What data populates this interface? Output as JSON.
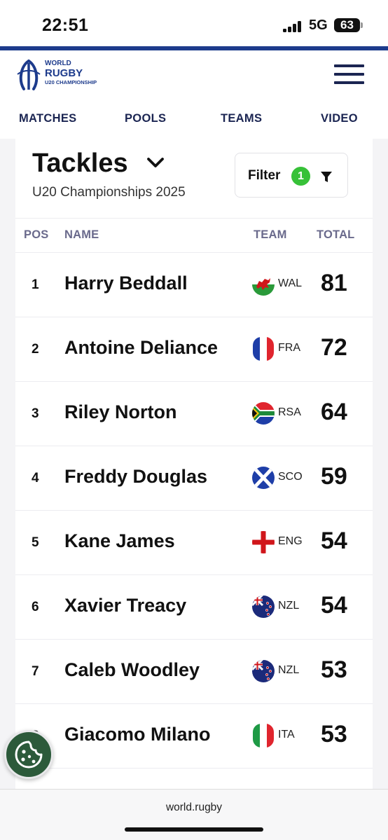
{
  "status_bar": {
    "time": "22:51",
    "network": "5G",
    "battery": "63"
  },
  "header": {
    "logo": {
      "line1": "WORLD",
      "line2": "RUGBY",
      "line3": "U20 CHAMPIONSHIP"
    },
    "nav": [
      "MATCHES",
      "POOLS",
      "TEAMS",
      "VIDEO"
    ]
  },
  "stats": {
    "title": "Tackles",
    "subtitle": "U20 Championships 2025",
    "filter": {
      "label": "Filter",
      "count": "1"
    },
    "columns": {
      "pos": "POS",
      "name": "NAME",
      "team": "TEAM",
      "total": "TOTAL"
    },
    "rows": [
      {
        "pos": "1",
        "name": "Harry Beddall",
        "team": "WAL",
        "total": "81",
        "flag": "wales-flag-icon"
      },
      {
        "pos": "2",
        "name": "Antoine Deliance",
        "team": "FRA",
        "total": "72",
        "flag": "france-flag-icon"
      },
      {
        "pos": "3",
        "name": "Riley Norton",
        "team": "RSA",
        "total": "64",
        "flag": "south-africa-flag-icon"
      },
      {
        "pos": "4",
        "name": "Freddy Douglas",
        "team": "SCO",
        "total": "59",
        "flag": "scotland-flag-icon"
      },
      {
        "pos": "5",
        "name": "Kane James",
        "team": "ENG",
        "total": "54",
        "flag": "england-flag-icon"
      },
      {
        "pos": "6",
        "name": "Xavier Treacy",
        "team": "NZL",
        "total": "54",
        "flag": "new-zealand-flag-icon"
      },
      {
        "pos": "7",
        "name": "Caleb Woodley",
        "team": "NZL",
        "total": "53",
        "flag": "new-zealand-flag-icon"
      },
      {
        "pos": "8",
        "name": "Giacomo Milano",
        "team": "ITA",
        "total": "53",
        "flag": "italy-flag-icon"
      }
    ]
  },
  "browser": {
    "url": "world.rugby"
  },
  "colors": {
    "brand_blue": "#1d3b8c",
    "nav_navy": "#1b2552",
    "filter_badge": "#37c138",
    "cookie_button": "#2c5a3a"
  }
}
